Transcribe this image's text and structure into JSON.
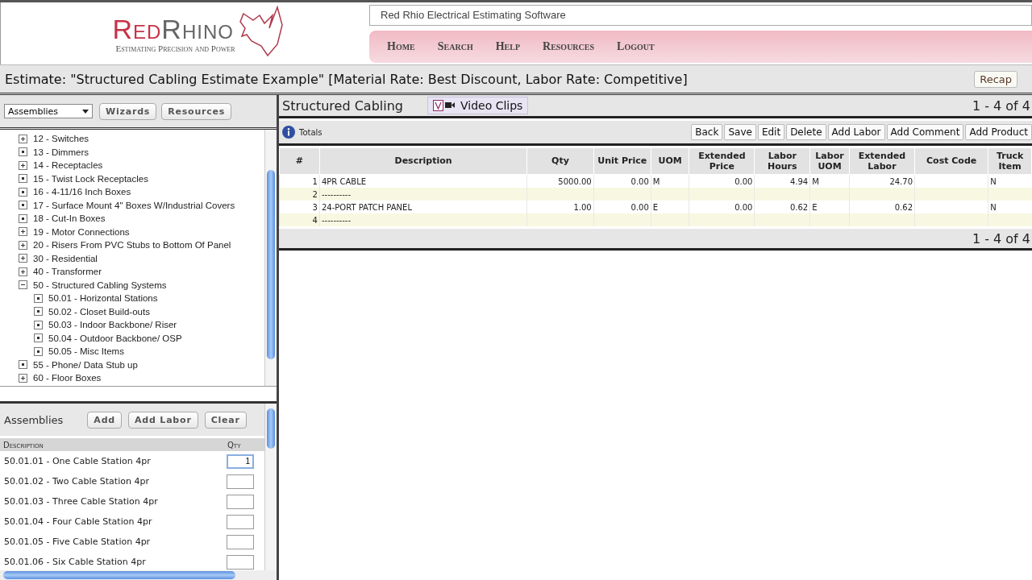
{
  "logo": {
    "word_1": "Red",
    "word_2": "Rhino",
    "tagline": "Estimating Precision and Power"
  },
  "app_title": "Red Rhio Electrical Estimating Software",
  "nav": [
    "Home",
    "Search",
    "Help",
    "Resources",
    "Logout"
  ],
  "estimate_title": "Estimate: \"Structured Cabling Estimate Example\" [Material Rate: Best Discount, Labor Rate: Competitive]",
  "recap_button": "Recap",
  "left_toolbar": {
    "dropdown": "Assemblies",
    "buttons": [
      "Wizards",
      "Resources"
    ]
  },
  "tree": [
    {
      "label": "12 - Switches",
      "kind": "folder",
      "expanded": false
    },
    {
      "label": "13 - Dimmers",
      "kind": "leaf"
    },
    {
      "label": "14 - Receptacles",
      "kind": "folder",
      "expanded": false
    },
    {
      "label": "15 - Twist Lock Receptacles",
      "kind": "leaf"
    },
    {
      "label": "16 - 4-11/16 Inch Boxes",
      "kind": "leaf"
    },
    {
      "label": "17 - Surface Mount 4\" Boxes W/Industrial Covers",
      "kind": "leaf"
    },
    {
      "label": "18 - Cut-In Boxes",
      "kind": "leaf"
    },
    {
      "label": "19 - Motor Connections",
      "kind": "folder",
      "expanded": false
    },
    {
      "label": "20 - Risers From PVC Stubs to Bottom Of Panel",
      "kind": "folder",
      "expanded": false
    },
    {
      "label": "30 - Residential",
      "kind": "folder",
      "expanded": false
    },
    {
      "label": "40 - Transformer",
      "kind": "folder",
      "expanded": false
    },
    {
      "label": "50 - Structured Cabling Systems",
      "kind": "folder",
      "expanded": true,
      "children": [
        {
          "label": "50.01 - Horizontal Stations",
          "kind": "leaf"
        },
        {
          "label": "50.02 - Closet Build-outs",
          "kind": "leaf"
        },
        {
          "label": "50.03 - Indoor Backbone/ Riser",
          "kind": "leaf"
        },
        {
          "label": "50.04 - Outdoor Backbone/ OSP",
          "kind": "leaf"
        },
        {
          "label": "50.05 - Misc Items",
          "kind": "leaf"
        }
      ]
    },
    {
      "label": "55 - Phone/ Data Stub up",
      "kind": "leaf"
    },
    {
      "label": "60 - Floor Boxes",
      "kind": "folder",
      "expanded": false
    }
  ],
  "assemblies": {
    "title": "Assemblies",
    "buttons": [
      "Add",
      "Add Labor",
      "Clear"
    ],
    "columns": [
      "Description",
      "Qty"
    ],
    "rows": [
      {
        "description": "50.01.01 - One Cable Station 4pr",
        "qty": "1"
      },
      {
        "description": "50.01.02 - Two Cable Station 4pr"
      },
      {
        "description": "50.01.03 - Three Cable Station 4pr"
      },
      {
        "description": "50.01.04 - Four Cable Station 4pr"
      },
      {
        "description": "50.01.05 - Five Cable Station 4pr"
      },
      {
        "description": "50.01.06 - Six Cable Station 4pr"
      }
    ]
  },
  "section": {
    "title": "Structured Cabling",
    "video_button": "Video Clips",
    "pager_top": "1 - 4 of 4",
    "pager_bottom": "1 - 4 of 4"
  },
  "totals_link": "Totals",
  "actions": [
    "Back",
    "Save",
    "Edit",
    "Delete",
    "Add Labor",
    "Add Comment",
    "Add Product"
  ],
  "table": {
    "columns": [
      "#",
      "Description",
      "Qty",
      "Unit Price",
      "UOM",
      "Extended Price",
      "Labor Hours",
      "Labor UOM",
      "Extended Labor",
      "Cost Code",
      "Truck Item"
    ],
    "rows": [
      [
        "1",
        "4PR CABLE",
        "5000.00",
        "0.00",
        "M",
        "0.00",
        "4.94",
        "M",
        "24.70",
        "",
        "N"
      ],
      [
        "2",
        "----------",
        "",
        "",
        "",
        "",
        "",
        "",
        "",
        "",
        ""
      ],
      [
        "3",
        "24-PORT PATCH PANEL",
        "1.00",
        "0.00",
        "E",
        "0.00",
        "0.62",
        "E",
        "0.62",
        "",
        "N"
      ],
      [
        "4",
        "----------",
        "",
        "",
        "",
        "",
        "",
        "",
        "",
        "",
        ""
      ]
    ]
  }
}
